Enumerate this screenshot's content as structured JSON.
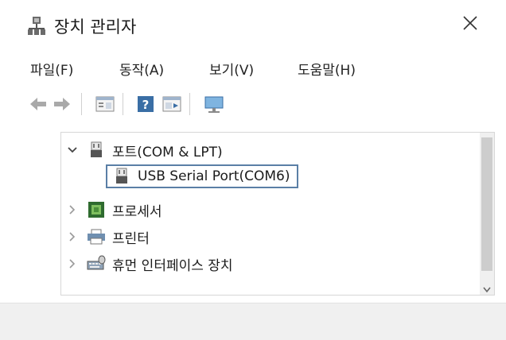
{
  "window": {
    "title": "장치 관리자"
  },
  "menu": {
    "items": [
      {
        "label": "파일(F)"
      },
      {
        "label": "동작(A)"
      },
      {
        "label": "보기(V)"
      },
      {
        "label": "도움말(H)"
      }
    ]
  },
  "toolbar": {
    "buttons": [
      {
        "icon": "back-arrow-icon"
      },
      {
        "icon": "forward-arrow-icon"
      },
      {
        "icon": "properties-icon"
      },
      {
        "icon": "help-icon"
      },
      {
        "icon": "update-driver-icon"
      },
      {
        "icon": "monitor-icon"
      }
    ]
  },
  "tree": {
    "ports": {
      "label": "포트(COM & LPT)",
      "expanded": true
    },
    "usb_serial": {
      "label": "USB Serial Port(COM6)",
      "selected": true
    },
    "processor": {
      "label": "프로세서"
    },
    "printer": {
      "label": "프린터"
    },
    "hid": {
      "label": "휴먼 인터페이스 장치"
    }
  },
  "colors": {
    "selection_border": "#5a7fa6",
    "toolbar_icon_blue": "#3a6ea5"
  }
}
